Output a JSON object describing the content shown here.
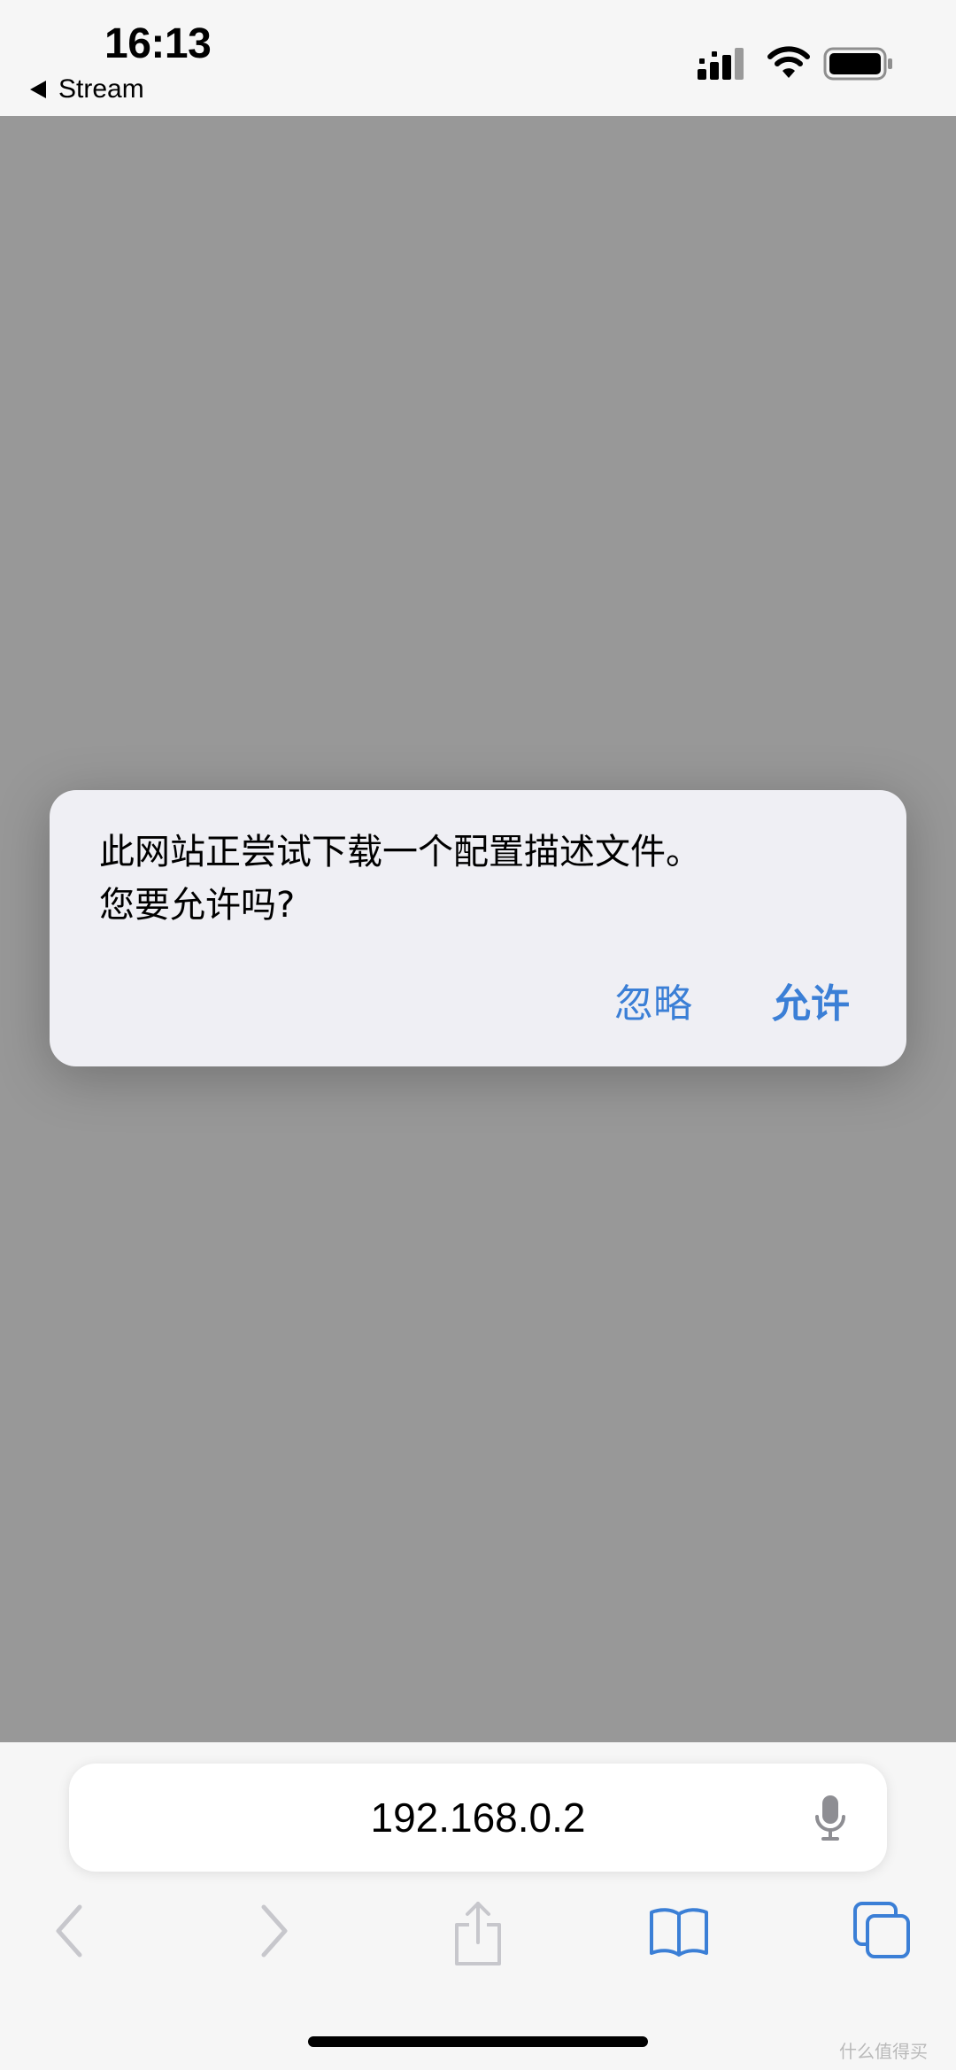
{
  "status_bar": {
    "time": "16:13",
    "back_app_label": "Stream"
  },
  "alert": {
    "message": "此网站正尝试下载一个配置描述文件。\n您要允许吗?",
    "buttons": {
      "ignore": "忽略",
      "allow": "允许"
    }
  },
  "browser": {
    "url": "192.168.0.2"
  },
  "watermark": "什么值得买",
  "colors": {
    "accent": "#3b7fd6",
    "dim_overlay": "#989898",
    "alert_background": "#efeff4",
    "bar_background": "#f6f6f6",
    "toolbar_disabled": "#c7c7cc",
    "toolbar_active": "#3b7fd6"
  },
  "icons": {
    "signal": "cellular-signal-icon",
    "wifi": "wifi-icon",
    "battery": "battery-icon",
    "mic": "microphone-icon",
    "back": "chevron-left-icon",
    "forward": "chevron-right-icon",
    "share": "share-icon",
    "bookmarks": "book-icon",
    "tabs": "tabs-icon"
  }
}
